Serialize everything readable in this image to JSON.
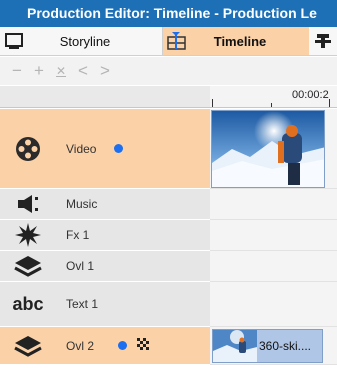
{
  "window": {
    "title": "Production Editor: Timeline - Production Le"
  },
  "tabs": {
    "storyline": {
      "label": "Storyline",
      "icon": "monitor-icon"
    },
    "timeline": {
      "label": "Timeline",
      "icon": "timeline-icon"
    },
    "extra": {
      "icon": "pin-icon"
    }
  },
  "toolbar": {
    "items": [
      {
        "label": "−",
        "icon": "minus-icon"
      },
      {
        "label": "+",
        "icon": "plus-icon"
      },
      {
        "label": "✕",
        "icon": "fit-icon"
      },
      {
        "label": "<",
        "icon": "previous-icon"
      },
      {
        "label": ">",
        "icon": "next-icon"
      }
    ]
  },
  "ruler": {
    "timecode": "00:00:2"
  },
  "tracks": {
    "video": {
      "label": "Video",
      "icon": "film-reel-icon"
    },
    "music": {
      "label": "Music",
      "icon": "speaker-icon"
    },
    "fx1": {
      "label": "Fx 1",
      "icon": "burst-icon"
    },
    "ovl1": {
      "label": "Ovl 1",
      "icon": "layers-icon"
    },
    "text1": {
      "label": "Text 1",
      "icon_text": "abc"
    },
    "ovl2": {
      "label": "Ovl 2",
      "icon": "layers-icon"
    }
  },
  "clips": {
    "ovl2": {
      "name": "360-ski...."
    }
  },
  "colors": {
    "title_bar": "#1d6fb6",
    "selected_track": "#fbd1a8",
    "track_header": "#e6e6e6",
    "dot": "#1c6ff0"
  }
}
